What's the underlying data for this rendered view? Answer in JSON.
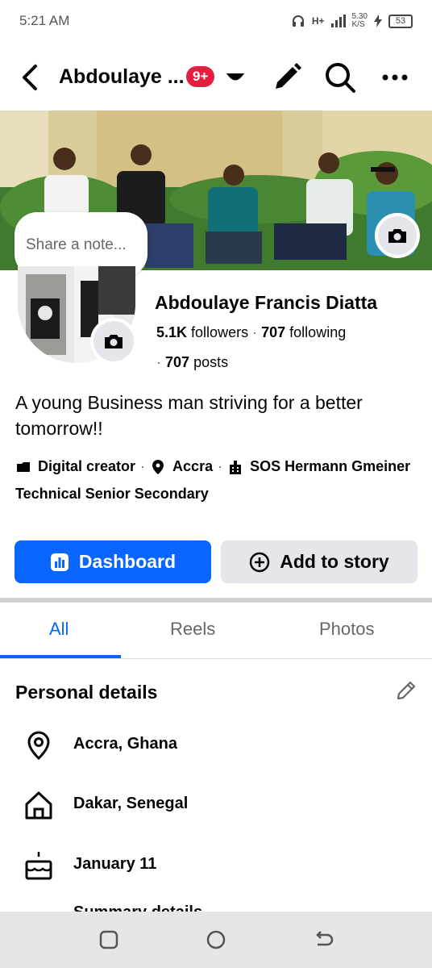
{
  "status_bar": {
    "time": "5:21 AM",
    "network": "H+",
    "speed": "5.30\nK/S",
    "battery": "53"
  },
  "header": {
    "title": "Abdoulaye ...",
    "badge": "9+"
  },
  "note": {
    "placeholder": "Share a note..."
  },
  "profile": {
    "name": "Abdoulaye Francis Diatta",
    "followers_count": "5.1K",
    "followers_label": "followers",
    "following_count": "707",
    "following_label": "following",
    "posts_count": "707",
    "posts_label": "posts",
    "bio": "A young Business man striving for a better tomorrow!!"
  },
  "info": {
    "category": "Digital creator",
    "location": "Accra",
    "school_line1": "SOS Hermann Gmeiner",
    "school_line2": "Technical Senior Secondary"
  },
  "buttons": {
    "dashboard": "Dashboard",
    "add_story": "Add to story"
  },
  "tabs": [
    {
      "label": "All",
      "active": true
    },
    {
      "label": "Reels"
    },
    {
      "label": "Photos"
    }
  ],
  "personal_details": {
    "title": "Personal details",
    "items": [
      {
        "icon": "location-pin-icon",
        "text": "Accra, Ghana"
      },
      {
        "icon": "home-icon",
        "text": "Dakar, Senegal"
      },
      {
        "icon": "birthday-cake-icon",
        "text": "January 11"
      }
    ],
    "partial_text": "Summary details"
  },
  "colors": {
    "accent": "#0866ff",
    "badge": "#e41e3f",
    "secondary_button": "#e4e6eb"
  }
}
